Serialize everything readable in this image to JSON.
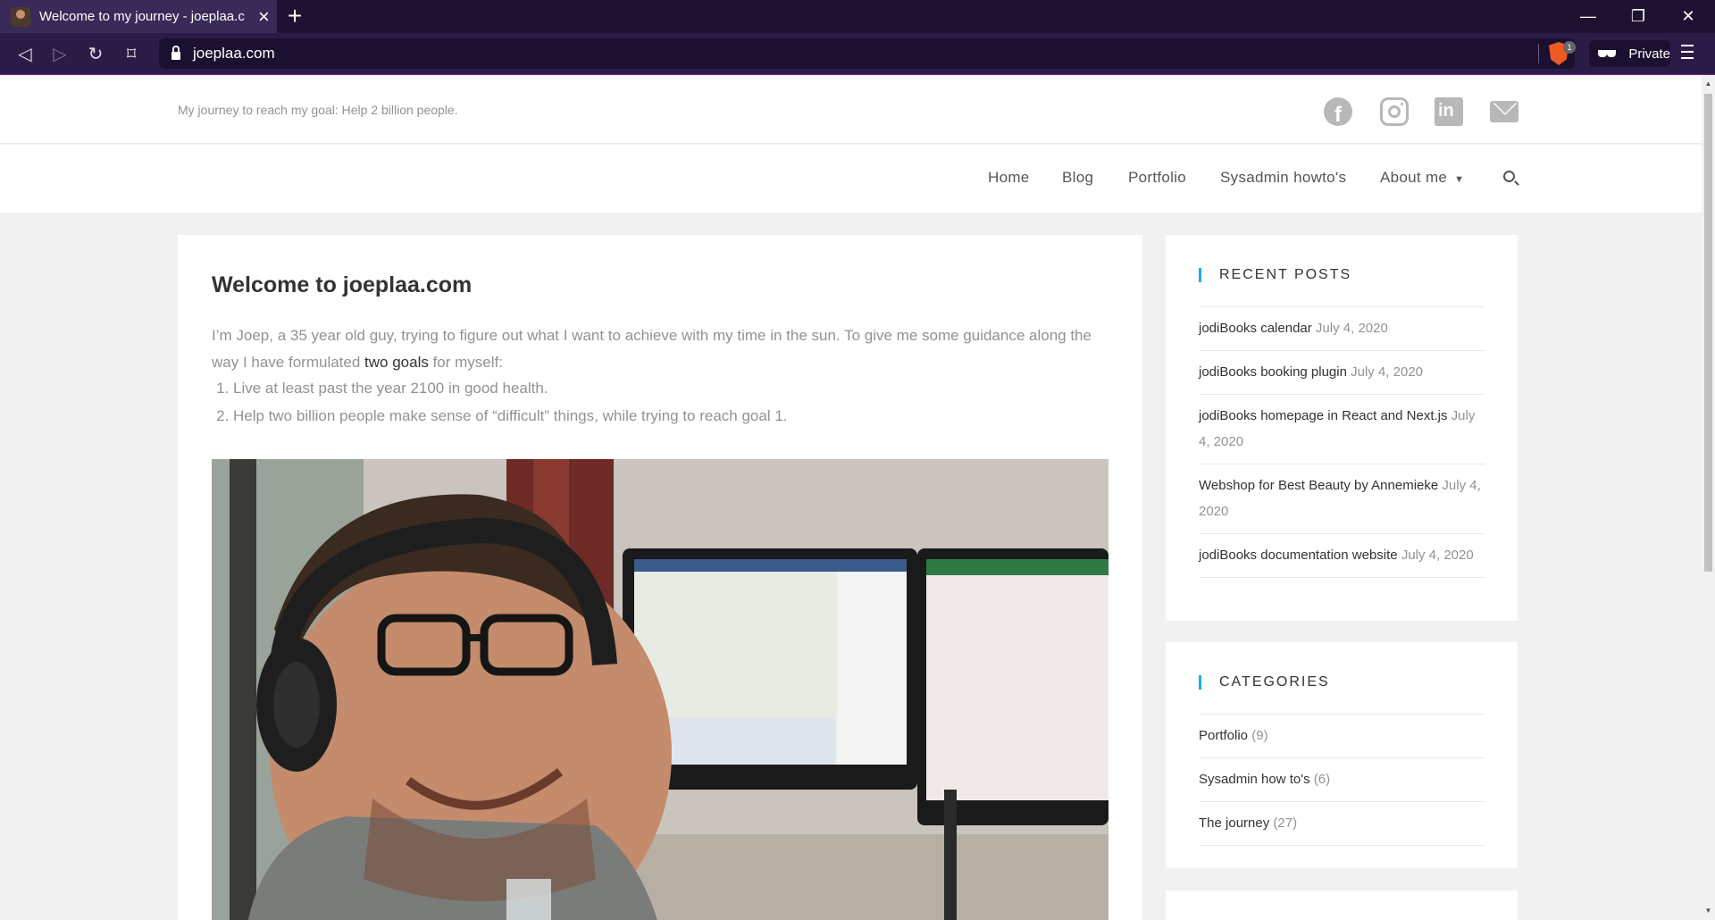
{
  "browser": {
    "tab_title": "Welcome to my journey - joeplaa.c",
    "url": "joeplaa.com",
    "shield_count": "1",
    "private_label": "Private"
  },
  "site": {
    "tagline": "My journey to reach my goal: Help 2 billion people.",
    "social_icons": [
      "facebook-icon",
      "instagram-icon",
      "linkedin-icon",
      "mail-icon"
    ],
    "nav": {
      "home": "Home",
      "blog": "Blog",
      "portfolio": "Portfolio",
      "sysadmin": "Sysadmin howto's",
      "about": "About me"
    },
    "accent_color": "#13aff0"
  },
  "post": {
    "title": "Welcome to joeplaa.com",
    "intro_before": "I’m Joep, a 35 year old guy, trying to figure out what I want to achieve with my time in the sun. To give me some guidance along the way I have formulated ",
    "intro_link": "two goals",
    "intro_after": " for myself:",
    "goal_1": "Live at least past the year 2100 in good health.",
    "goal_2": "Help two billion people make sense of “difficult” things, while trying to reach goal 1."
  },
  "sidebar": {
    "recent_posts": {
      "title": "RECENT POSTS",
      "items": [
        {
          "title": "jodiBooks calendar",
          "date": "July 4, 2020"
        },
        {
          "title": "jodiBooks booking plugin",
          "date": "July 4, 2020"
        },
        {
          "title": "jodiBooks homepage in React and Next.js",
          "date": "July 4, 2020"
        },
        {
          "title": "Webshop for Best Beauty by Annemieke",
          "date": "July 4, 2020"
        },
        {
          "title": "jodiBooks documentation website",
          "date": "July 4, 2020"
        }
      ]
    },
    "categories": {
      "title": "CATEGORIES",
      "items": [
        {
          "name": "Portfolio",
          "count": "(9)"
        },
        {
          "name": "Sysadmin how to's",
          "count": "(6)"
        },
        {
          "name": "The journey",
          "count": "(27)"
        }
      ]
    }
  }
}
